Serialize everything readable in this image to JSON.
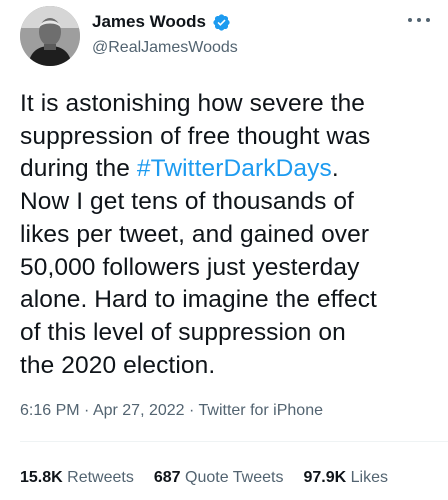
{
  "author": {
    "display_name": "James Woods",
    "handle": "@RealJamesWoods",
    "verified": true
  },
  "tweet": {
    "text_lines": [
      {
        "before": "It is astonishing how severe the",
        "hashtag": "",
        "after": ""
      },
      {
        "before": "suppression of free thought was",
        "hashtag": "",
        "after": ""
      },
      {
        "before": "during the ",
        "hashtag": "#TwitterDarkDays",
        "after": "."
      },
      {
        "before": "Now I get tens of thousands of",
        "hashtag": "",
        "after": ""
      },
      {
        "before": "likes per tweet, and gained over",
        "hashtag": "",
        "after": ""
      },
      {
        "before": "50,000 followers just yesterday",
        "hashtag": "",
        "after": ""
      },
      {
        "before": "alone. Hard to imagine the effect",
        "hashtag": "",
        "after": ""
      },
      {
        "before": "of this level of suppression on",
        "hashtag": "",
        "after": ""
      },
      {
        "before": "the 2020 election.",
        "hashtag": "",
        "after": ""
      }
    ],
    "time": "6:16 PM",
    "separator": " · ",
    "date": "Apr 27, 2022",
    "source": "Twitter for iPhone"
  },
  "stats": {
    "retweets": {
      "count": "15.8K",
      "label": "Retweets"
    },
    "quote_tweets": {
      "count": "687",
      "label": "Quote Tweets"
    },
    "likes": {
      "count": "97.9K",
      "label": "Likes"
    }
  },
  "colors": {
    "accent": "#1d9bf0",
    "text": "#0f1419",
    "secondary": "#536471"
  },
  "icons": {
    "verified": "verified-badge-icon",
    "more": "more-options-icon"
  }
}
